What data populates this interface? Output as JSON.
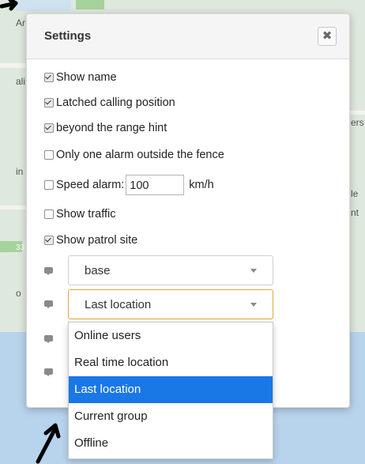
{
  "settings": {
    "title": "Settings",
    "close_symbol": "✖",
    "options": [
      {
        "label": "Show name",
        "checked": true
      },
      {
        "label": "Latched calling position",
        "checked": true
      },
      {
        "label": "beyond the range hint",
        "checked": true
      },
      {
        "label": "Only one alarm outside the fence",
        "checked": false
      },
      {
        "label": "Speed alarm:",
        "checked": false
      },
      {
        "label": "Show traffic",
        "checked": false
      },
      {
        "label": "Show patrol site",
        "checked": true
      }
    ],
    "speed_value": "100",
    "speed_unit": "km/h",
    "select_base": "base",
    "select_location": "Last location",
    "dropdown_options": [
      "Online users",
      "Real time location",
      "Last location",
      "Current group",
      "Offline"
    ],
    "dropdown_selected": "Last location"
  },
  "map": {
    "labels": [
      "Ar",
      "ali",
      "ers",
      "in",
      "le",
      "nt",
      "33",
      "o"
    ]
  },
  "colors": {
    "accent_selected": "#1a77e6",
    "select_focus_border": "#e0a83a",
    "map_water": "#b8d3ec"
  }
}
